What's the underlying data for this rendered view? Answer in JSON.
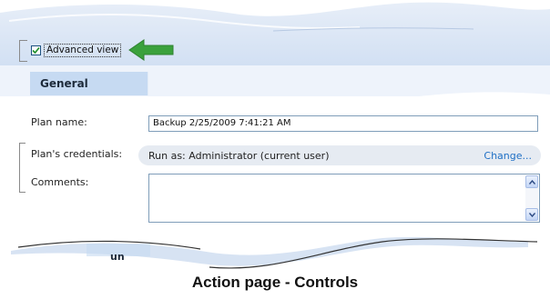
{
  "toolbar": {
    "advanced_view_label": "Advanced view",
    "advanced_view_checked": true
  },
  "tabs": {
    "general": "General",
    "next_partial": "un"
  },
  "form": {
    "plan_name_label": "Plan name:",
    "plan_name_value": "Backup 2/25/2009 7:41:21 AM",
    "credentials_label": "Plan's credentials:",
    "credentials_value": "Run as: Administrator (current user)",
    "credentials_change": "Change...",
    "comments_label": "Comments:"
  },
  "caption": "Action page - Controls",
  "colors": {
    "accent_arrow": "#3aa13c",
    "panel_blue": "#c6daf2",
    "link": "#1f6fc5"
  },
  "icons": [
    "checkmark-icon",
    "green-arrow-icon",
    "scroll-up-icon",
    "scroll-down-icon"
  ]
}
